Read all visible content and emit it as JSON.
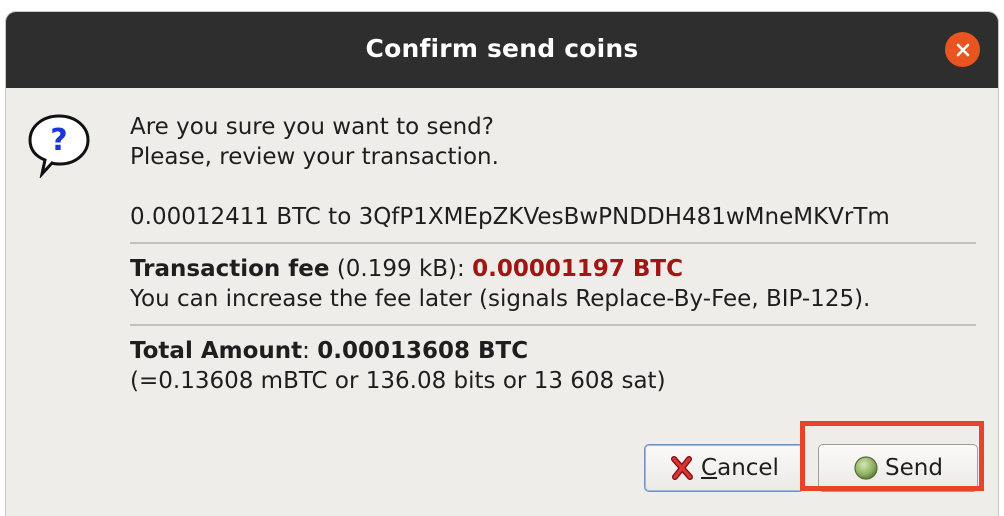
{
  "dialog": {
    "title": "Confirm send coins"
  },
  "message": {
    "line1": "Are you sure you want to send?",
    "line2": "Please, review your transaction.",
    "recipient_line": "0.00012411 BTC to 3QfP1XMEpZKVesBwPNDDH481wMneMKVrTm"
  },
  "fee": {
    "label": "Transaction fee",
    "size": " (0.199 kB): ",
    "amount": "0.00001197 BTC",
    "note": "You can increase the fee later (signals Replace-By-Fee, BIP-125)."
  },
  "total": {
    "label": "Total Amount",
    "sep": ": ",
    "amount": "0.00013608 BTC",
    "alt_units": "(=0.13608 mBTC or 136.08 bits or 13 608 sat)"
  },
  "buttons": {
    "cancel_first": "C",
    "cancel_rest": "ancel",
    "send": "Send"
  },
  "colors": {
    "titlebar": "#2e2e2e",
    "close": "#e95420",
    "fee_amount": "#a31515",
    "highlight": "#e8442a"
  },
  "icons": {
    "close": "close-icon",
    "question": "question-bubble-icon",
    "cancel": "red-x-icon",
    "send": "green-circle-icon"
  }
}
